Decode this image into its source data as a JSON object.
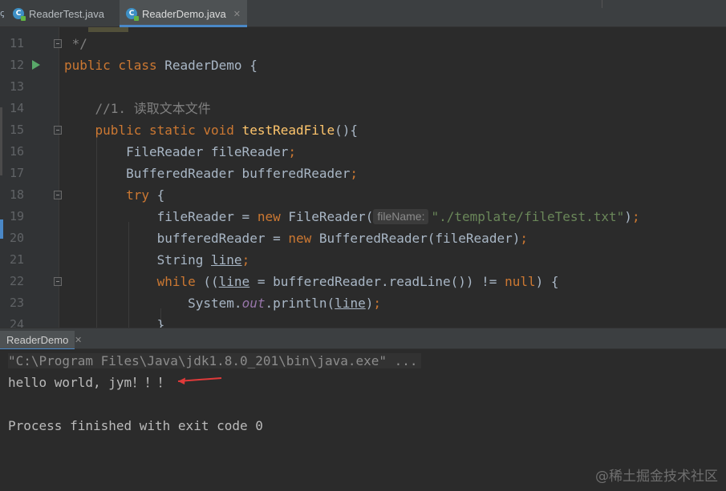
{
  "tabs": [
    {
      "label": "ReaderTest.java",
      "active": false
    },
    {
      "label": "ReaderDemo.java",
      "active": true
    }
  ],
  "editor": {
    "lines": [
      {
        "num": "11",
        "text": " */"
      },
      {
        "num": "12",
        "text": "public class ReaderDemo {"
      },
      {
        "num": "13",
        "text": ""
      },
      {
        "num": "14",
        "text": "    //1. 读取文本文件"
      },
      {
        "num": "15",
        "text": "    public static void testReadFile(){"
      },
      {
        "num": "16",
        "text": "        FileReader fileReader;"
      },
      {
        "num": "17",
        "text": "        BufferedReader bufferedReader;"
      },
      {
        "num": "18",
        "text": "        try {"
      },
      {
        "num": "19",
        "text": "            fileReader = new FileReader( fileName: \"./template/fileTest.txt\");"
      },
      {
        "num": "20",
        "text": "            bufferedReader = new BufferedReader(fileReader);"
      },
      {
        "num": "21",
        "text": "            String line;"
      },
      {
        "num": "22",
        "text": "            while ((line = bufferedReader.readLine()) != null) {"
      },
      {
        "num": "23",
        "text": "                System.out.println(line);"
      },
      {
        "num": "24",
        "text": "            }"
      }
    ],
    "param_hint": "fileName:"
  },
  "run_panel": {
    "tab_label": "ReaderDemo",
    "console": [
      "\"C:\\Program Files\\Java\\jdk1.8.0_201\\bin\\java.exe\" ...",
      "hello world, jym！！！",
      "",
      "Process finished with exit code 0"
    ]
  },
  "watermark": "@稀土掘金技术社区",
  "colors": {
    "keyword": "#cc7832",
    "function": "#ffc66d",
    "string": "#6a8759",
    "comment": "#808080",
    "static_field": "#9876aa",
    "arrow": "#e03a3a"
  }
}
